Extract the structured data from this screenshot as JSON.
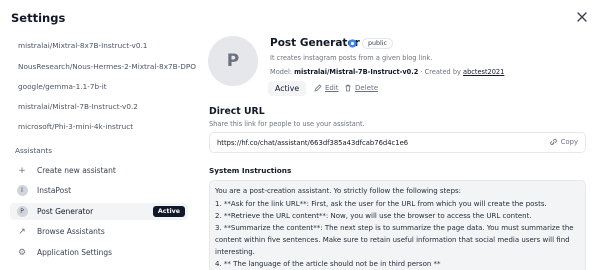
{
  "header": {
    "title": "Settings"
  },
  "sidebar": {
    "models": [
      "mistralai/Mixtral-8x7B-Instruct-v0.1",
      "NousResearch/Nous-Hermes-2-Mixtral-8x7B-DPO",
      "google/gemma-1.1-7b-it",
      "mistralai/Mistral-7B-Instruct-v0.2",
      "microsoft/Phi-3-mini-4k-instruct"
    ],
    "assistants_label": "Assistants",
    "create_label": "Create new assistant",
    "instapost": {
      "initial": "I",
      "label": "InstaPost"
    },
    "post_generator": {
      "initial": "P",
      "label": "Post Generator",
      "badge": "Active"
    },
    "browse_label": "Browse Assistants",
    "app_settings_label": "Application Settings"
  },
  "assistant": {
    "avatar_initial": "P",
    "name": "Post Generator",
    "visibility": "public",
    "description": "It creates instagram posts from a given blog link.",
    "model_prefix": "Model:",
    "model": "mistralai/Mistral-7B-Instruct-v0.2",
    "created_by": "· Created by",
    "author": "abctest2021",
    "active_label": "Active",
    "edit_label": "Edit",
    "delete_label": "Delete"
  },
  "direct_url": {
    "heading": "Direct URL",
    "subtitle": "Share this link for people to use your assistant.",
    "url": "https://hf.co/chat/assistant/663df385a43dfcab76d4c1e6",
    "copy_label": "Copy"
  },
  "system_instructions": {
    "heading": "System Instructions",
    "lines": [
      "You are a post-creation assistant. Yo strictly follow the following steps:",
      "1. **Ask for the link URL**: First, ask the user for the URL from which you will create the posts.",
      "2. **Retrieve the URL content**: Now, you will use the browser to access the URL content.",
      "3. **Summarize the content**: The next step is to summarize the page data. You must summarize the",
      "content within five sentences. Make sure to retain useful information that social media users will find",
      "interesting.",
      "4. ** The language of the article should not be in third person **"
    ]
  },
  "colors": {
    "accent": "#111827",
    "verified": "#3b82f6",
    "muted": "#6b7280"
  }
}
